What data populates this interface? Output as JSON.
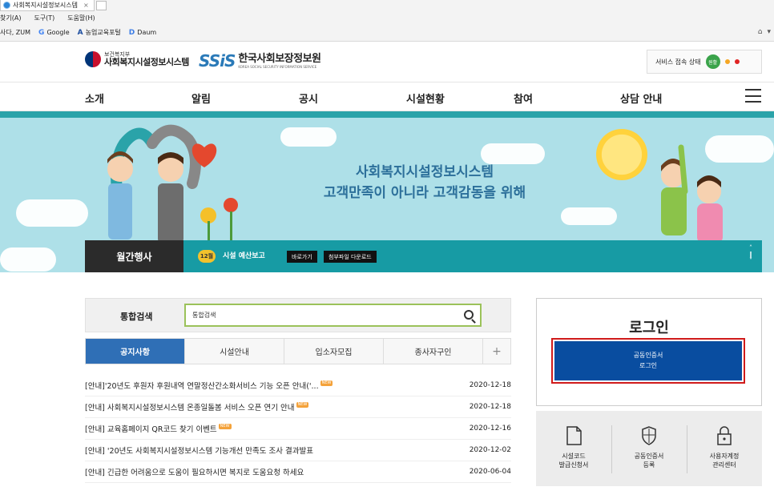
{
  "browser": {
    "tab_title": "사회복지시설정보시스템",
    "menu": [
      "찾기(A)",
      "도구(T)",
      "도움말(H)"
    ],
    "favorites": [
      "사다, ZUM",
      "Google",
      "농업교육포털",
      "Daum"
    ]
  },
  "header": {
    "logo1_small": "보건복지부",
    "logo1_big": "사회복지시설정보시스템",
    "logo2_mark": "SSiS",
    "logo2_big": "한국사회보장정보원",
    "logo2_small": "KOREA SOCIAL SECURITY INFORMATION SERVICE",
    "status_label": "서비스 접속 상태",
    "status_value": "원활"
  },
  "gnb": [
    "소개",
    "알림",
    "공시",
    "시설현황",
    "참여",
    "상담 안내"
  ],
  "banner": {
    "line1": "사회복지시설정보시스템",
    "line2": "고객만족이 아니라 고객감동을 위해"
  },
  "monthly": {
    "label": "월간행사",
    "month": "12월",
    "event": "시설 예산보고",
    "btn_go": "바로가기",
    "btn_download": "첨부파일 다운로드"
  },
  "search": {
    "label": "통합검색",
    "value": "통합검색"
  },
  "tabs": [
    "공지사항",
    "시설안내",
    "입소자모집",
    "종사자구인"
  ],
  "tabs_more": "+",
  "news_badge": "NEW",
  "news": [
    {
      "title": "[안내]'20년도 후원자 후원내역 연말정산간소화서비스 기능 오픈 안내('...",
      "date": "2020-12-18",
      "new": true
    },
    {
      "title": "[안내] 사회복지시설정보시스템 온종일돌봄 서비스 오픈 연기 안내",
      "date": "2020-12-18",
      "new": true
    },
    {
      "title": "[안내] 교육홈페이지 QR코드 찾기 이벤트",
      "date": "2020-12-16",
      "new": true
    },
    {
      "title": "[안내] '20년도 사회복지시설정보시스템 기능개선 만족도 조사 결과발표",
      "date": "2020-12-02",
      "new": false
    },
    {
      "title": "[안내] 긴급한 어려움으로 도움이 필요하시면 복지로 도움요청 하세요",
      "date": "2020-06-04",
      "new": false
    }
  ],
  "login": {
    "title": "로그인",
    "btn_line1": "공동인증서",
    "btn_line2": "로그인"
  },
  "quick": [
    {
      "line1": "시설코드",
      "line2": "발급신청서",
      "icon": "document-icon"
    },
    {
      "line1": "공동인증서",
      "line2": "등록",
      "icon": "shield-icon"
    },
    {
      "line1": "사용자계정",
      "line2": "관리센터",
      "icon": "lock-icon"
    }
  ],
  "colors": {
    "primary": "#2f6fb6",
    "login": "#094da0",
    "teal": "#179ba4",
    "highlight": "#d01b1b"
  }
}
